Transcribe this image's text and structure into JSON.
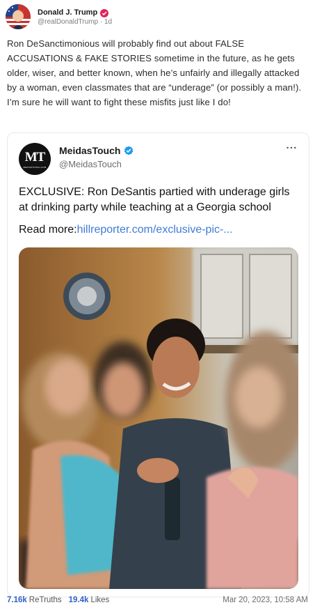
{
  "post": {
    "author_name": "Donald J. Trump",
    "author_handle": "@realDonaldTrump",
    "separator": "·",
    "age": "1d",
    "verified_color": "#e0245e",
    "text": "Ron DeSanctimonious will probably find out about FALSE ACCUSATIONS & FAKE STORIES sometime in the future, as he gets older, wiser, and better known, when he’s unfairly and illegally attacked by a woman, even classmates that are “underage” (or possibly a man!). I’m sure he will want to fight these misfits just like I do!"
  },
  "quoted": {
    "avatar_text": "MT",
    "avatar_subtext": "MEIDASTOUCH.COM",
    "author_name": "MeidasTouch",
    "author_handle": "@MeidasTouch",
    "verified_color": "#1d9bf0",
    "more_icon": "more-horizontal-icon",
    "text": "EXCLUSIVE: Ron DeSantis partied with underage girls at drinking party while teaching at a Georgia school",
    "read_more_label": "Read more:",
    "link_text": "hillreporter.com/exclusive-pic-...",
    "link_color": "#3f7bd8"
  },
  "stats": {
    "retruths_count": "7.16k",
    "retruths_label": "ReTruths",
    "likes_count": "19.4k",
    "likes_label": "Likes",
    "timestamp": "Mar 20, 2023, 10:58 AM"
  }
}
